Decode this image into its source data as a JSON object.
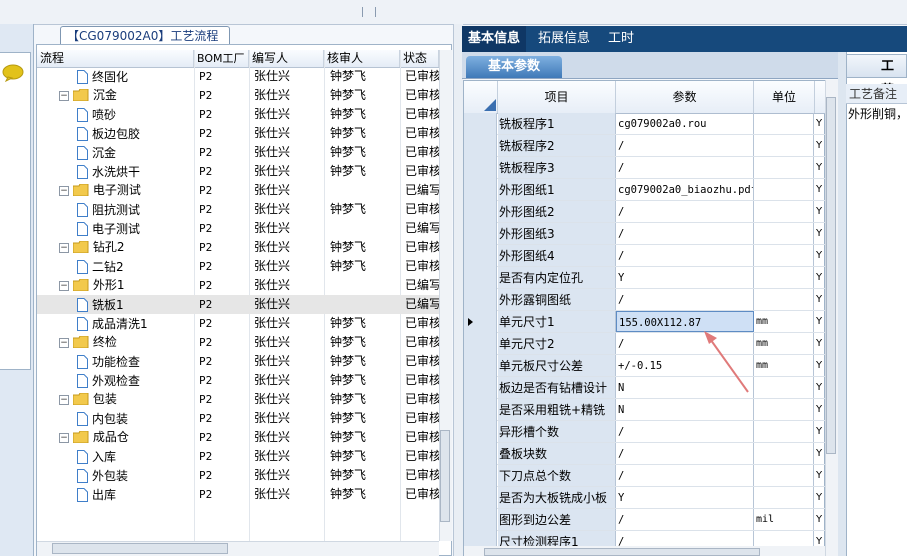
{
  "tree": {
    "title": "【CG079002A0】工艺流程",
    "headers": [
      "流程",
      "BOM工厂",
      "编写人",
      "核审人",
      "状态"
    ],
    "rows": [
      {
        "name": "终固化",
        "level": 1,
        "type": "doc",
        "bom": "P2",
        "writer": "张仕兴",
        "checker": "钟梦飞",
        "status": "已审核"
      },
      {
        "name": "沉金",
        "level": 0,
        "type": "folder",
        "bom": "P2",
        "writer": "张仕兴",
        "checker": "钟梦飞",
        "status": "已审核"
      },
      {
        "name": "喷砂",
        "level": 1,
        "type": "doc",
        "bom": "P2",
        "writer": "张仕兴",
        "checker": "钟梦飞",
        "status": "已审核"
      },
      {
        "name": "板边包胶",
        "level": 1,
        "type": "doc",
        "bom": "P2",
        "writer": "张仕兴",
        "checker": "钟梦飞",
        "status": "已审核"
      },
      {
        "name": "沉金",
        "level": 1,
        "type": "doc",
        "bom": "P2",
        "writer": "张仕兴",
        "checker": "钟梦飞",
        "status": "已审核"
      },
      {
        "name": "水洗烘干",
        "level": 1,
        "type": "doc",
        "bom": "P2",
        "writer": "张仕兴",
        "checker": "钟梦飞",
        "status": "已审核"
      },
      {
        "name": "电子测试",
        "level": 0,
        "type": "folder",
        "bom": "P2",
        "writer": "张仕兴",
        "checker": "",
        "status": "已编写"
      },
      {
        "name": "阻抗测试",
        "level": 1,
        "type": "doc",
        "bom": "P2",
        "writer": "张仕兴",
        "checker": "钟梦飞",
        "status": "已审核"
      },
      {
        "name": "电子测试",
        "level": 1,
        "type": "doc",
        "bom": "P2",
        "writer": "张仕兴",
        "checker": "",
        "status": "已编写"
      },
      {
        "name": "钻孔2",
        "level": 0,
        "type": "folder",
        "bom": "P2",
        "writer": "张仕兴",
        "checker": "钟梦飞",
        "status": "已审核"
      },
      {
        "name": "二钻2",
        "level": 1,
        "type": "doc",
        "bom": "P2",
        "writer": "张仕兴",
        "checker": "钟梦飞",
        "status": "已审核"
      },
      {
        "name": "外形1",
        "level": 0,
        "type": "folder",
        "bom": "P2",
        "writer": "张仕兴",
        "checker": "",
        "status": "已编写"
      },
      {
        "name": "铣板1",
        "level": 1,
        "type": "doc",
        "bom": "P2",
        "writer": "张仕兴",
        "checker": "",
        "status": "已编写",
        "selected": true
      },
      {
        "name": "成品清洗1",
        "level": 1,
        "type": "doc",
        "bom": "P2",
        "writer": "张仕兴",
        "checker": "钟梦飞",
        "status": "已审核"
      },
      {
        "name": "终检",
        "level": 0,
        "type": "folder",
        "bom": "P2",
        "writer": "张仕兴",
        "checker": "钟梦飞",
        "status": "已审核"
      },
      {
        "name": "功能检查",
        "level": 1,
        "type": "doc",
        "bom": "P2",
        "writer": "张仕兴",
        "checker": "钟梦飞",
        "status": "已审核"
      },
      {
        "name": "外观检查",
        "level": 1,
        "type": "doc",
        "bom": "P2",
        "writer": "张仕兴",
        "checker": "钟梦飞",
        "status": "已审核"
      },
      {
        "name": "包装",
        "level": 0,
        "type": "folder",
        "bom": "P2",
        "writer": "张仕兴",
        "checker": "钟梦飞",
        "status": "已审核"
      },
      {
        "name": "内包装",
        "level": 1,
        "type": "doc",
        "bom": "P2",
        "writer": "张仕兴",
        "checker": "钟梦飞",
        "status": "已审核"
      },
      {
        "name": "成品仓",
        "level": 0,
        "type": "folder",
        "bom": "P2",
        "writer": "张仕兴",
        "checker": "钟梦飞",
        "status": "已审核"
      },
      {
        "name": "入库",
        "level": 1,
        "type": "doc",
        "bom": "P2",
        "writer": "张仕兴",
        "checker": "钟梦飞",
        "status": "已审核"
      },
      {
        "name": "外包装",
        "level": 1,
        "type": "doc",
        "bom": "P2",
        "writer": "张仕兴",
        "checker": "钟梦飞",
        "status": "已审核"
      },
      {
        "name": "出库",
        "level": 1,
        "type": "doc",
        "bom": "P2",
        "writer": "张仕兴",
        "checker": "钟梦飞",
        "status": "已审核"
      }
    ]
  },
  "tabs": [
    "基本信息",
    "拓展信息",
    "工时"
  ],
  "subtab": "基本参数",
  "grid": {
    "headers": [
      "项目",
      "参数",
      "单位"
    ],
    "rows": [
      {
        "item": "铣板程序1",
        "value": "cg079002a0.rou",
        "unit": "",
        "flag": "Y"
      },
      {
        "item": "铣板程序2",
        "value": "/",
        "unit": "",
        "flag": "Y"
      },
      {
        "item": "铣板程序3",
        "value": "/",
        "unit": "",
        "flag": "Y"
      },
      {
        "item": "外形图纸1",
        "value": "cg079002a0_biaozhu.pdf",
        "unit": "",
        "flag": "Y"
      },
      {
        "item": "外形图纸2",
        "value": "/",
        "unit": "",
        "flag": "Y"
      },
      {
        "item": "外形图纸3",
        "value": "/",
        "unit": "",
        "flag": "Y"
      },
      {
        "item": "外形图纸4",
        "value": "/",
        "unit": "",
        "flag": "Y"
      },
      {
        "item": "是否有内定位孔",
        "value": "Y",
        "unit": "",
        "flag": "Y"
      },
      {
        "item": "外形露铜图纸",
        "value": "/",
        "unit": "",
        "flag": "Y"
      },
      {
        "item": "单元尺寸1",
        "value": "155.00X112.87",
        "unit": "mm",
        "flag": "Y",
        "selected": true
      },
      {
        "item": "单元尺寸2",
        "value": "/",
        "unit": "mm",
        "flag": "Y"
      },
      {
        "item": "单元板尺寸公差",
        "value": "+/-0.15",
        "unit": "mm",
        "flag": "Y"
      },
      {
        "item": "板边是否有钻槽设计",
        "value": "N",
        "unit": "",
        "flag": "Y"
      },
      {
        "item": "是否采用粗铣+精铣",
        "value": "N",
        "unit": "",
        "flag": "Y"
      },
      {
        "item": "异形槽个数",
        "value": "/",
        "unit": "",
        "flag": "Y"
      },
      {
        "item": "叠板块数",
        "value": "/",
        "unit": "",
        "flag": "Y"
      },
      {
        "item": "下刀点总个数",
        "value": "/",
        "unit": "",
        "flag": "Y"
      },
      {
        "item": "是否为大板铣成小板",
        "value": "Y",
        "unit": "",
        "flag": "Y"
      },
      {
        "item": "图形到边公差",
        "value": "/",
        "unit": "mil",
        "flag": "Y"
      },
      {
        "item": "尺寸检测程序1",
        "value": "/",
        "unit": "",
        "flag": "Y"
      }
    ]
  },
  "right_panel": {
    "tab": "工艺",
    "header": "工艺备注",
    "text": "外形削铜，"
  },
  "colors": {
    "tab_bar": "#16497c",
    "arrow": "#e07a7a"
  }
}
